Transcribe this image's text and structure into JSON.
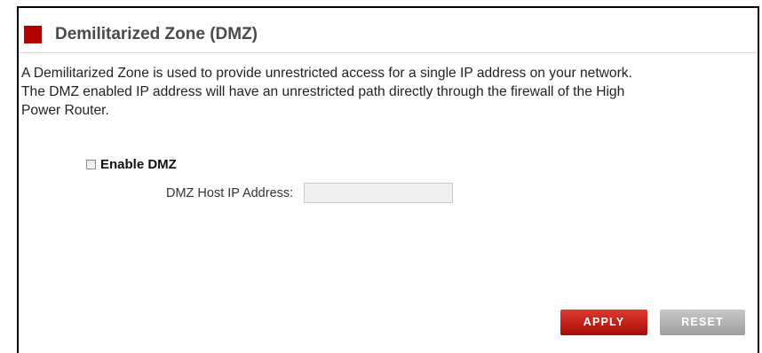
{
  "section": {
    "title": "Demilitarized Zone (DMZ)",
    "accent_color": "#b30000",
    "description": "A Demilitarized Zone is used to provide unrestricted access for a single IP address on your network.\nThe DMZ enabled IP address will have an unrestricted path directly through the firewall of the High\nPower Router."
  },
  "form": {
    "enable_label": "Enable DMZ",
    "enable_checked": false,
    "host_ip_label": "DMZ Host IP Address:",
    "host_ip_value": "",
    "host_ip_placeholder": ""
  },
  "buttons": {
    "apply_label": "APPLY",
    "reset_label": "RESET"
  },
  "icons": {
    "section_marker": "red-square-icon",
    "checkbox": "checkbox-unchecked-icon"
  }
}
